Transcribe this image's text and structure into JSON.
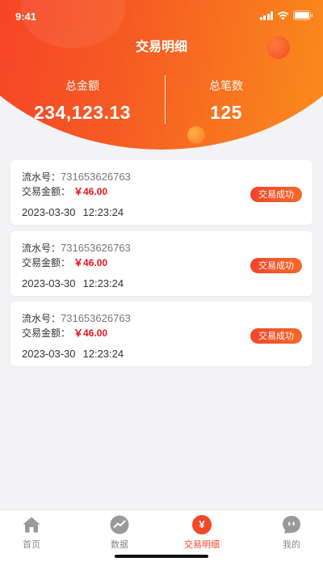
{
  "status_bar": {
    "time": "9:41"
  },
  "header": {
    "title": "交易明细",
    "total_amount_label": "总金额",
    "total_amount_value": "234,123.13",
    "total_count_label": "总笔数",
    "total_count_value": "125"
  },
  "transactions": [
    {
      "serial_label": "流水号：",
      "serial_value": "731653626763",
      "amount_label": "交易金额：",
      "amount_value": "￥46.00",
      "date": "2023-03-30",
      "time": "12:23:24",
      "status": "交易成功"
    },
    {
      "serial_label": "流水号：",
      "serial_value": "731653626763",
      "amount_label": "交易金额：",
      "amount_value": "￥46.00",
      "date": "2023-03-30",
      "time": "12:23:24",
      "status": "交易成功"
    },
    {
      "serial_label": "流水号：",
      "serial_value": "731653626763",
      "amount_label": "交易金额：",
      "amount_value": "￥46.00",
      "date": "2023-03-30",
      "time": "12:23:24",
      "status": "交易成功"
    }
  ],
  "tabbar": {
    "items": [
      {
        "label": "首页",
        "icon": "home-icon"
      },
      {
        "label": "数据",
        "icon": "chart-icon"
      },
      {
        "label": "交易明细",
        "icon": "yen-icon",
        "glyph": "¥"
      },
      {
        "label": "我的",
        "icon": "profile-icon"
      }
    ],
    "active_index": 2
  },
  "colors": {
    "accent": "#f2452c",
    "amount": "#e7141a",
    "header_gradient_start": "#f5342a",
    "header_gradient_end": "#fb9a1a"
  }
}
